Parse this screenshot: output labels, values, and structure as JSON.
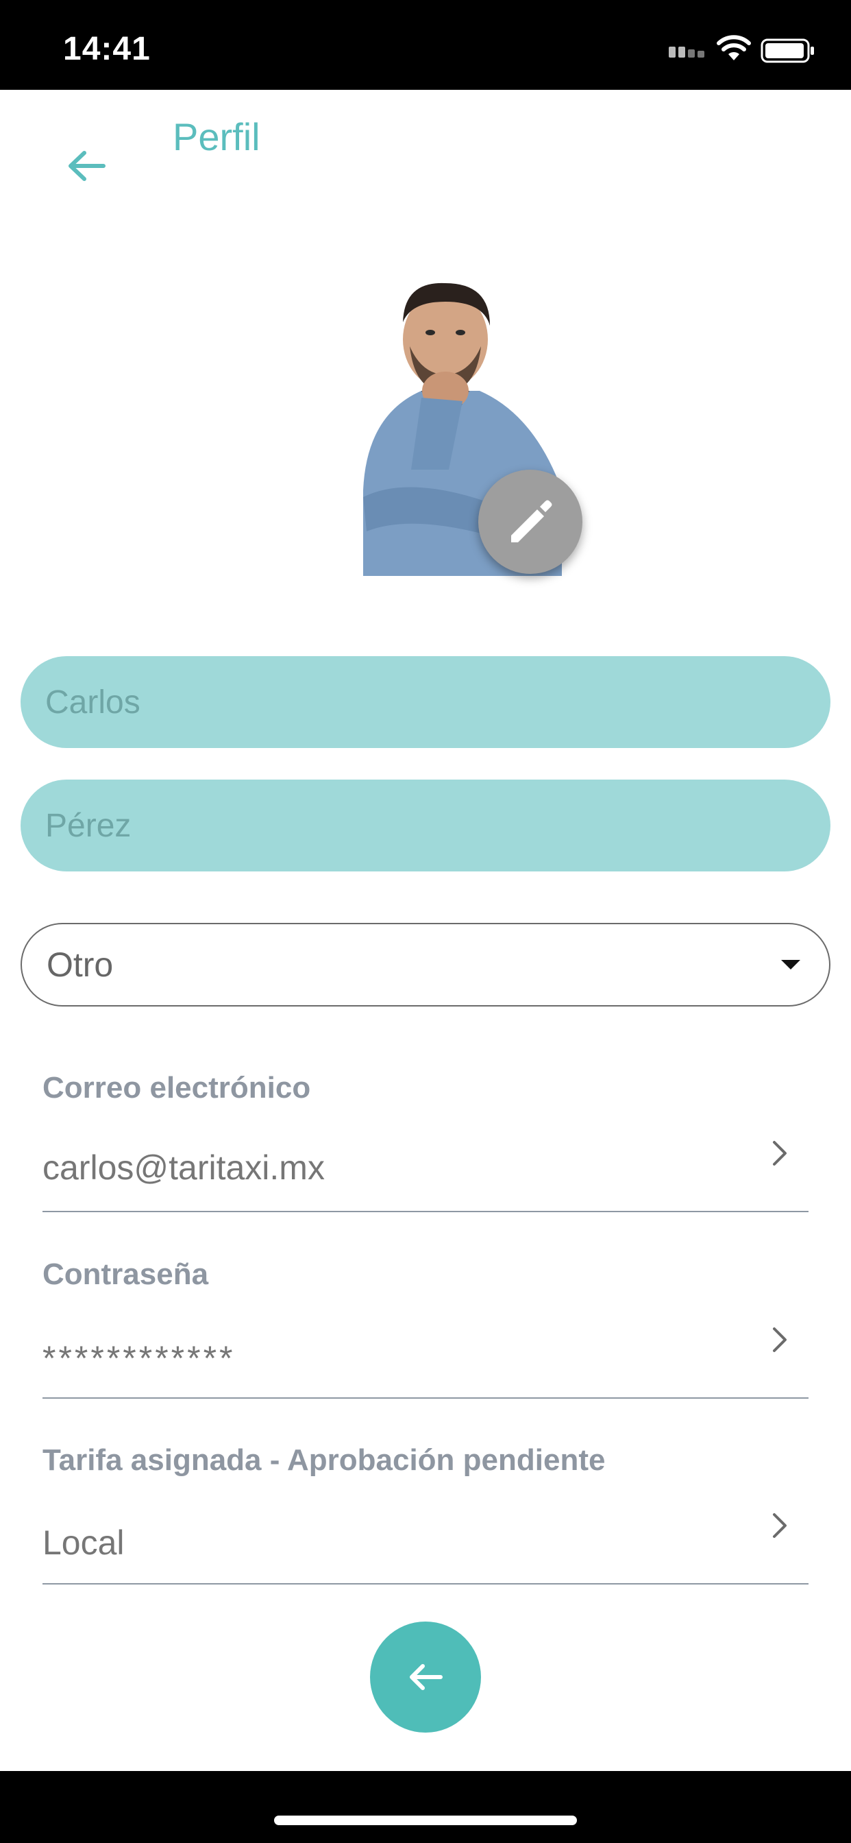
{
  "status_bar": {
    "time": "14:41"
  },
  "header": {
    "title": "Perfil",
    "back_icon": "arrow-left-icon"
  },
  "avatar": {
    "edit_icon": "pencil-icon"
  },
  "form": {
    "first_name": "Carlos",
    "last_name": "Pérez",
    "gender": "Otro",
    "email_label": "Correo electrónico",
    "email_value": "carlos@taritaxi.mx",
    "password_label": "Contraseña",
    "password_value": "************",
    "tariff_label": "Tarifa asignada - Aprobación pendiente",
    "tariff_value": "Local"
  },
  "colors": {
    "accent": "#5bbdbd",
    "input_fill": "#9fd9d9",
    "fab": "#4fbdb8"
  }
}
